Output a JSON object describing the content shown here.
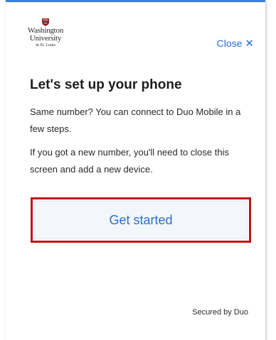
{
  "logo": {
    "line1": "Washington",
    "line2": "University",
    "line3": "in St. Louis"
  },
  "header": {
    "close_label": "Close",
    "close_glyph": "✕"
  },
  "main": {
    "title": "Let's set up your phone",
    "paragraph1": "Same number? You can connect to Duo Mobile in a few steps.",
    "paragraph2": "If you got a new number, you'll need to close this screen and add a new device.",
    "get_started_label": "Get started"
  },
  "footer": {
    "secured_text": "Secured by Duo"
  },
  "colors": {
    "accent": "#2b6fd6",
    "top_border": "#3d7fd9",
    "highlight": "#c2141a",
    "button_bg": "#f3f6fa"
  },
  "icons": {
    "close": "close-icon",
    "logo_crest": "crest-icon"
  }
}
